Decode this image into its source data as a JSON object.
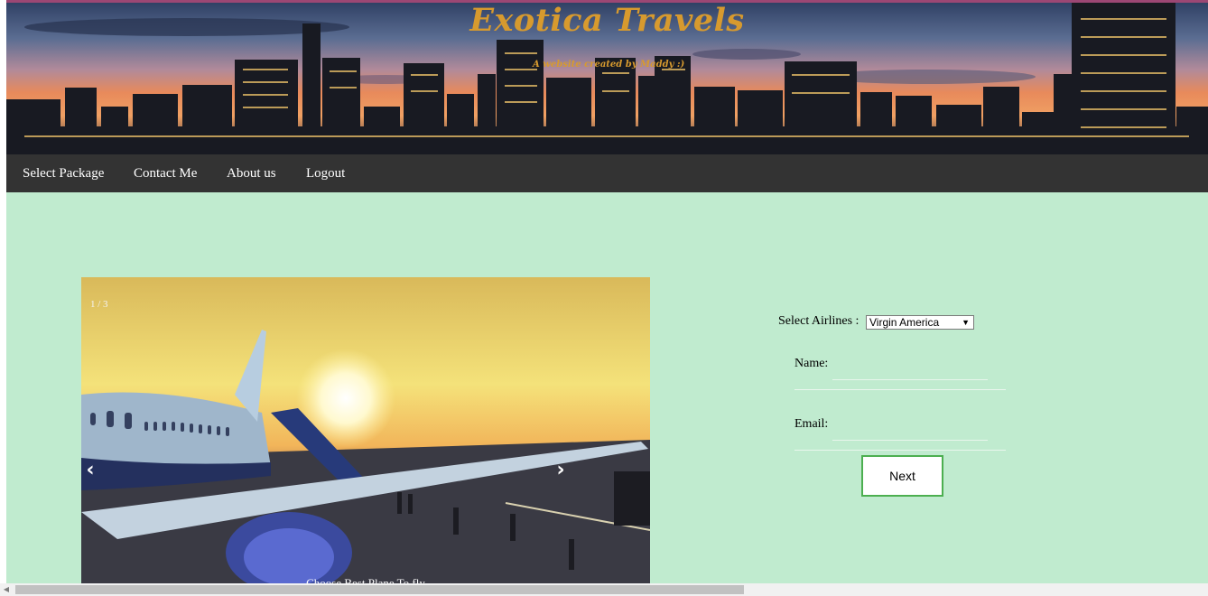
{
  "header": {
    "title": "Exotica Travels",
    "subtitle": "A website created by Maddy :)"
  },
  "nav": {
    "items": [
      {
        "label": "Select Package"
      },
      {
        "label": "Contact Me"
      },
      {
        "label": "About us"
      },
      {
        "label": "Logout"
      }
    ]
  },
  "slideshow": {
    "counter": "1 / 3",
    "prev_icon": "chevron-left-icon",
    "prev_glyph": "‹",
    "next_icon": "chevron-right-icon",
    "next_glyph": "›",
    "caption": "Choose Best Plane To fly"
  },
  "form": {
    "airline_label": "Select Airlines :",
    "airline_selected": "Virgin America",
    "name_label": "Name:",
    "name_value": "",
    "email_label": "Email:",
    "email_value": "",
    "next_label": "Next"
  },
  "colors": {
    "page_background": "#c0ebcf",
    "navbar": "#333333",
    "title": "#d79a2e",
    "button_border": "#4caf50"
  }
}
